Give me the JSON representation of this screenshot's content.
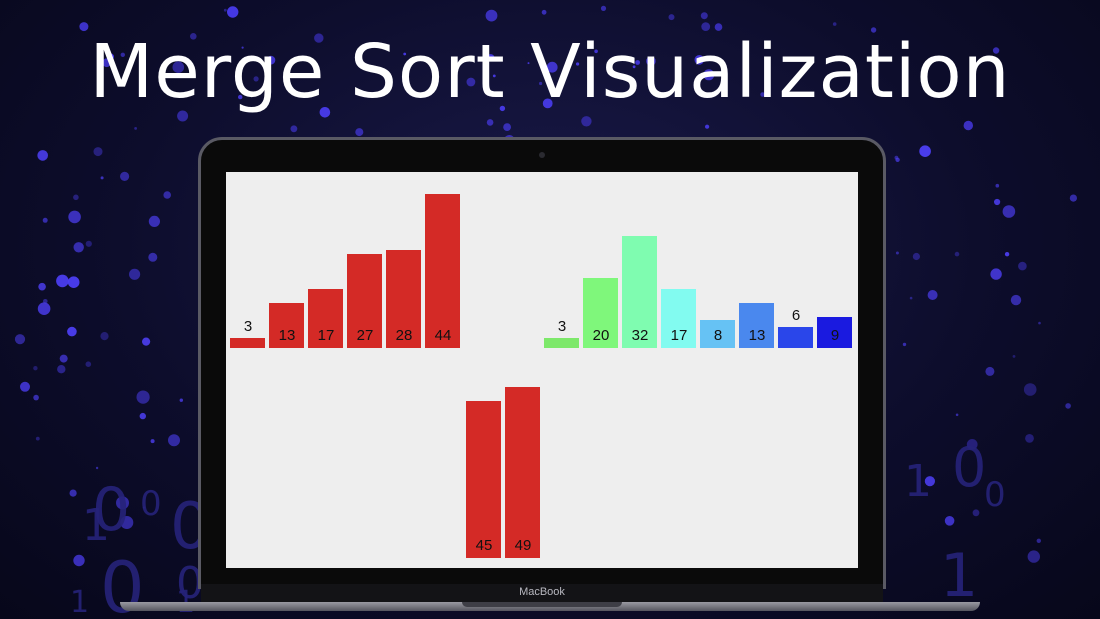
{
  "title": "Merge Sort Visualization",
  "brand": "MacBook",
  "colors": {
    "red": "#d42a26",
    "background": "#eeeeee"
  },
  "groups": [
    {
      "name": "left-merged-group",
      "bars": [
        {
          "value": 3,
          "color": "#d42a26"
        },
        {
          "value": 13,
          "color": "#d42a26"
        },
        {
          "value": 17,
          "color": "#d42a26"
        },
        {
          "value": 27,
          "color": "#d42a26"
        },
        {
          "value": 28,
          "color": "#d42a26"
        },
        {
          "value": 44,
          "color": "#d42a26"
        }
      ]
    },
    {
      "name": "right-unsorted-group",
      "bars": [
        {
          "value": 3,
          "color": "#7de86a"
        },
        {
          "value": 20,
          "color": "#7ff77b"
        },
        {
          "value": 32,
          "color": "#7ffcb0"
        },
        {
          "value": 17,
          "color": "#82fbf0"
        },
        {
          "value": 8,
          "color": "#66c2f4"
        },
        {
          "value": 13,
          "color": "#4a88ee"
        },
        {
          "value": 6,
          "color": "#2a46ea"
        },
        {
          "value": 9,
          "color": "#1a1ae0"
        }
      ]
    },
    {
      "name": "lower-merging-group",
      "bars": [
        {
          "value": 45,
          "color": "#d42a26"
        },
        {
          "value": 49,
          "color": "#d42a26"
        }
      ]
    }
  ],
  "background_digits": [
    "1",
    "0",
    "0",
    "0",
    "1",
    "0",
    "0",
    "1",
    "1",
    "0",
    "0",
    "1"
  ]
}
